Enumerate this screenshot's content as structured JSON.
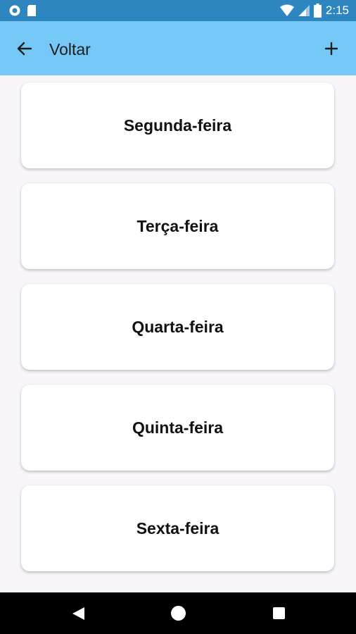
{
  "status_bar": {
    "time": "2:15",
    "icons": [
      "notification-circle-icon",
      "sd-card-icon",
      "wifi-icon",
      "signal-icon",
      "battery-icon"
    ]
  },
  "app_bar": {
    "back_icon": "arrow-left-icon",
    "title": "Voltar",
    "add_icon": "plus-icon"
  },
  "days": [
    {
      "label": "Segunda-feira"
    },
    {
      "label": "Terça-feira"
    },
    {
      "label": "Quarta-feira"
    },
    {
      "label": "Quinta-feira"
    },
    {
      "label": "Sexta-feira"
    }
  ],
  "navigation": {
    "icons": [
      "back-triangle-icon",
      "home-circle-icon",
      "recents-square-icon"
    ]
  },
  "colors": {
    "status_bar": "#2e86c1",
    "app_bar": "#75c8f5",
    "background": "#f8f6fa",
    "card": "#ffffff",
    "nav_bar": "#000000"
  }
}
